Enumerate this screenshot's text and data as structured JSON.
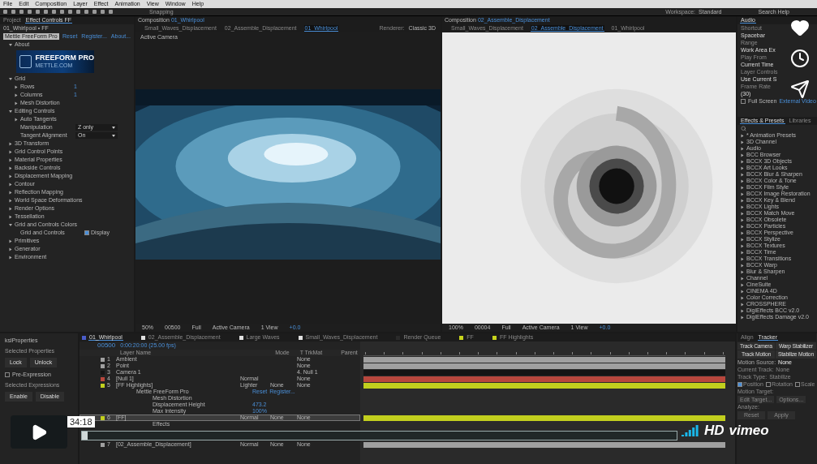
{
  "menu": [
    "File",
    "Edit",
    "Composition",
    "Layer",
    "Effect",
    "Animation",
    "View",
    "Window",
    "Help"
  ],
  "toolbar": {
    "snapping": "Snapping",
    "workspace_label": "Workspace:",
    "workspace": "Standard",
    "search": "Search Help"
  },
  "effect_controls": {
    "tabs": [
      {
        "label": "Project",
        "selected": false
      },
      {
        "label": "Effect Controls FF",
        "selected": true
      }
    ],
    "layer": "01_Whirlpool • FF",
    "effect": "Mettle FreeForm Pro",
    "links": [
      "Reset",
      "Register...",
      "About..."
    ],
    "items": [
      {
        "kind": "group",
        "label": "About",
        "expanded": true,
        "children": [
          {
            "kind": "banner",
            "label": "FREEFORM PRO",
            "sub": "METTLE.COM"
          }
        ]
      },
      {
        "kind": "group",
        "label": "Grid",
        "expanded": true,
        "children": [
          {
            "kind": "group",
            "label": "Rows",
            "expanded": false,
            "value": "1"
          },
          {
            "kind": "group",
            "label": "Columns",
            "expanded": false,
            "value": "1"
          },
          {
            "kind": "group",
            "label": "Mesh Distortion",
            "expanded": false
          }
        ]
      },
      {
        "kind": "group",
        "label": "Editing Controls",
        "expanded": true,
        "children": [
          {
            "kind": "group",
            "label": "Auto Tangents",
            "expanded": false
          },
          {
            "kind": "select",
            "label": "Manipulation",
            "value": "Z only"
          },
          {
            "kind": "select",
            "label": "Tangent Alignment",
            "value": "On"
          }
        ]
      },
      {
        "kind": "group",
        "label": "3D Transform",
        "expanded": false
      },
      {
        "kind": "group",
        "label": "Grid Control Points",
        "expanded": false
      },
      {
        "kind": "group",
        "label": "Material Properties",
        "expanded": false
      },
      {
        "kind": "group",
        "label": "Backside Controls",
        "expanded": false
      },
      {
        "kind": "group",
        "label": "Displacement Mapping",
        "expanded": false
      },
      {
        "kind": "group",
        "label": "Contour",
        "expanded": false
      },
      {
        "kind": "group",
        "label": "Reflection Mapping",
        "expanded": false
      },
      {
        "kind": "group",
        "label": "World Space Deformations",
        "expanded": false
      },
      {
        "kind": "group",
        "label": "Render Options",
        "expanded": false
      },
      {
        "kind": "group",
        "label": "Tessellation",
        "expanded": false
      },
      {
        "kind": "group",
        "label": "Grid and Controls Colors",
        "expanded": true,
        "children": [
          {
            "kind": "check",
            "label": "Grid and Controls",
            "value": "Display",
            "checked": true
          }
        ]
      },
      {
        "kind": "group",
        "label": "Primitives",
        "expanded": false
      },
      {
        "kind": "group",
        "label": "Generator",
        "expanded": false
      },
      {
        "kind": "group",
        "label": "Environment",
        "expanded": false
      }
    ]
  },
  "viewers": [
    {
      "tab": "Composition",
      "comp": "01_Whirlpool",
      "crumbs": [
        {
          "label": "Small_Waves_Displacement",
          "selected": false
        },
        {
          "label": "02_Assemble_Displacement",
          "selected": false
        },
        {
          "label": "01_Whirlpool",
          "selected": true
        }
      ],
      "renderer_label": "Renderer:",
      "renderer": "Classic 3D",
      "camera": "Active Camera",
      "kind": "whirlpool",
      "bar": [
        "50%",
        "00500",
        "Full",
        "Active Camera",
        "1 View",
        "+0.0"
      ]
    },
    {
      "tab": "Composition",
      "comp": "02_Assemble_Displacement",
      "crumbs": [
        {
          "label": "Small_Waves_Displacement",
          "selected": false
        },
        {
          "label": "02_Assemble_Displacement",
          "selected": true
        },
        {
          "label": "01_Whirlpool",
          "selected": false
        }
      ],
      "kind": "swirl",
      "bar": [
        "100%",
        "00004",
        "Full",
        "Active Camera",
        "1 View",
        "+0.0"
      ]
    }
  ],
  "preview": {
    "tab": "Audio",
    "fields": [
      {
        "label": "Shortcut",
        "value": "Spacebar"
      },
      {
        "label": "Range",
        "value": "Work Area Ex"
      },
      {
        "label": "Play From",
        "value": "Current Time"
      },
      {
        "label": "Layer Controls",
        "value": "Use Current S"
      },
      {
        "label": "Frame Rate",
        "value": "(30)"
      }
    ],
    "full_screen": {
      "label": "Full Screen",
      "checked": false
    },
    "link": "External Video"
  },
  "effects_presets": {
    "tabs": [
      {
        "label": "Effects & Presets",
        "selected": true
      },
      {
        "label": "Libraries",
        "selected": false
      }
    ],
    "items": [
      "* Animation Presets",
      "3D Channel",
      "Audio",
      "BCC Browser",
      "BCCX 3D Objects",
      "BCCX Art Looks",
      "BCCX Blur & Sharpen",
      "BCCX Color & Tone",
      "BCCX Film Style",
      "BCCX Image Restoration",
      "BCCX Key & Blend",
      "BCCX Lights",
      "BCCX Match Move",
      "BCCX Obsolete",
      "BCCX Particles",
      "BCCX Perspective",
      "BCCX Stylize",
      "BCCX Textures",
      "BCCX Time",
      "BCCX Transitions",
      "BCCX Warp",
      "Blur & Sharpen",
      "Channel",
      "CineSuite",
      "CINEMA 4D",
      "Color Correction",
      "CROSSPHERE",
      "DigiEffects BCC v2.0",
      "DigiEffects Damage v2.0"
    ]
  },
  "properties_panel": {
    "title": "kslProperties",
    "sections": [
      {
        "label": "Selected Properties",
        "buttons": [
          "Lock",
          "Unlock"
        ]
      },
      {
        "label": "Selected Expressions",
        "buttons": [
          "Enable",
          "Disable"
        ]
      }
    ],
    "checkbox": {
      "label": "Pre-Expression",
      "checked": false
    }
  },
  "timeline": {
    "tabs": [
      {
        "label": "01_Whirlpool",
        "selected": true,
        "color": "#4a5cc8"
      },
      {
        "label": "02_Assemble_Displacement",
        "selected": false,
        "color": "#e0e0e0"
      },
      {
        "label": "Large Waves",
        "selected": false,
        "color": "#e0e0e0"
      },
      {
        "label": "Small_Waves_Displacement",
        "selected": false,
        "color": "#e0e0e0"
      },
      {
        "label": "Render Queue",
        "selected": false,
        "color": "#2a2a2a"
      },
      {
        "label": "FF",
        "selected": false,
        "color": "#c8d41c"
      },
      {
        "label": "FF Highlights",
        "selected": false,
        "color": "#c8d41c"
      }
    ],
    "timecode": "00500",
    "fps": "0:00:20:00 (25.00 fps)",
    "columns": [
      "Layer Name",
      "Mode",
      "T  TrkMat",
      "Parent"
    ],
    "rows": [
      {
        "kind": "layer",
        "num": "1",
        "name": "Ambient",
        "color": "#a0a0a0",
        "parent": "None",
        "selected": false
      },
      {
        "kind": "layer",
        "num": "2",
        "name": "Point",
        "color": "#a0a0a0",
        "parent": "None",
        "selected": false
      },
      {
        "kind": "layer",
        "num": "3",
        "name": "Camera 1",
        "color": "#151515",
        "parent": "4. Null 1",
        "selected": false
      },
      {
        "kind": "layer",
        "num": "4",
        "name": "[Null 1]",
        "color": "#b8473d",
        "mode": "Normal",
        "parent": "None",
        "selected": false
      },
      {
        "kind": "layer",
        "num": "5",
        "name": "[FF Highlights]",
        "color": "#c2cf1e",
        "mode": "Lighter",
        "trkmat": "None",
        "parent": "None",
        "selected": false
      },
      {
        "kind": "prop",
        "name": "Mettle FreeForm Pro",
        "links": [
          "Reset",
          "Register..."
        ]
      },
      {
        "kind": "prop",
        "name": "Mesh Distortion"
      },
      {
        "kind": "prop",
        "name": "Displacement Height",
        "value": "473.2"
      },
      {
        "kind": "prop",
        "name": "Max Intensity",
        "value": "100%"
      },
      {
        "kind": "layer",
        "num": "6",
        "name": "[FF]",
        "color": "#c2cf1e",
        "mode": "Normal",
        "trkmat": "None",
        "parent": "None",
        "selected": true
      },
      {
        "kind": "prop",
        "name": "Effects"
      },
      {
        "kind": "gap"
      },
      {
        "kind": "layer",
        "num": "7",
        "name": "[02_Assemble_Displacement]",
        "color": "#a0a0a0",
        "mode": "Normal",
        "trkmat": "None",
        "parent": "None",
        "selected": false
      }
    ]
  },
  "tracker": {
    "tabs": [
      {
        "label": "Align",
        "selected": false
      },
      {
        "label": "Tracker",
        "selected": true
      }
    ],
    "buttons": [
      "Track Camera",
      "Warp Stabilizer",
      "Track Motion",
      "Stabilize Motion"
    ],
    "fields": [
      {
        "label": "Motion Source:",
        "value": "None",
        "disabled": false
      },
      {
        "label": "Current Track:",
        "value": "None",
        "disabled": true
      },
      {
        "label": "Track Type:",
        "value": "Stabilize",
        "disabled": true
      }
    ],
    "options": [
      {
        "label": "Position",
        "checked": true
      },
      {
        "label": "Rotation",
        "checked": false
      },
      {
        "label": "Scale",
        "checked": false
      }
    ],
    "target_label": "Motion Target:",
    "target_buttons": [
      "Edit Target...",
      "Options..."
    ],
    "analyze": "Analyze:",
    "actions": [
      "Reset",
      "Apply"
    ]
  },
  "player": {
    "time": "34:18",
    "hd": "HD",
    "brand": "vimeo",
    "progress": {
      "level": 0.01
    }
  }
}
